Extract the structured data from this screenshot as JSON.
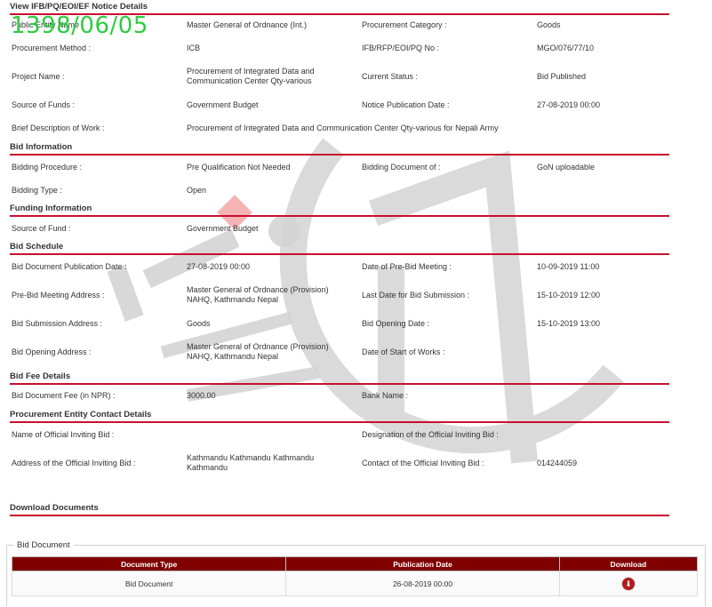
{
  "stamp": "1398/06/05",
  "notice": {
    "title": "View IFB/PQ/EOI/EF Notice Details",
    "pe_label": "Public Entity Name :",
    "pe_value": "Master General of Ordnance (Int.)",
    "cat_label": "Procurement Category :",
    "cat_value": "Goods",
    "method_label": "Procurement Method :",
    "method_value": "ICB",
    "ifb_label": "IFB/RFP/EOI/PQ No :",
    "ifb_value": "MGO/076/77/10",
    "project_label": "Project Name :",
    "project_value": "Procurement of Integrated Data and Communication Center Qty-various",
    "status_label": "Current Status :",
    "status_value": "Bid Published",
    "funds_label": "Source of Funds :",
    "funds_value": "Government Budget",
    "pubdate_label": "Notice Publication Date :",
    "pubdate_value": "27-08-2019 00:00",
    "brief_label": "Brief Description of Work :",
    "brief_value": "Procurement of Integrated Data and Communication Center Qty-various for Nepali Army"
  },
  "bid_info": {
    "title": "Bid Information",
    "proc_label": "Bidding Procedure :",
    "proc_value": "Pre Qualification Not Needed",
    "doc_label": "Bidding Document of :",
    "doc_value": "GoN uploadable",
    "type_label": "Bidding Type :",
    "type_value": "Open"
  },
  "funding": {
    "title": "Funding Information",
    "source_label": "Source of Fund :",
    "source_value": "Government Budget"
  },
  "schedule": {
    "title": "Bid Schedule",
    "docpub_label": "Bid Document Publication Date :",
    "docpub_value": "27-08-2019 00:00",
    "prebid_label": "Date of Pre-Bid Meeting :",
    "prebid_value": "10-09-2019 11:00",
    "prebid_addr_label": "Pre-Bid Meeting Address :",
    "prebid_addr_value": "Master General of Ordnance (Provision) NAHQ, Kathmandu Nepal",
    "lastdate_label": "Last Date for Bid Submission :",
    "lastdate_value": "15-10-2019 12:00",
    "sub_addr_label": "Bid Submission Address :",
    "sub_addr_value": "Goods",
    "opening_label": "Bid Opening Date :",
    "opening_value": "15-10-2019 13:00",
    "open_addr_label": "Bid Opening Address :",
    "open_addr_value": "Master General of Ordnance (Provision) NAHQ, Kathmandu Nepal",
    "start_label": "Date of Start of Works :",
    "start_value": ""
  },
  "fee": {
    "title": "Bid Fee Details",
    "fee_label": "Bid Document Fee (in NPR) :",
    "fee_value": "3000.00",
    "bank_label": "Bank Name :",
    "bank_value": ""
  },
  "contact": {
    "title": "Procurement Entity Contact Details",
    "official_label": "Name of Official Inviting Bid :",
    "official_value": "",
    "designation_label": "Designation of the Official Inviting Bid :",
    "designation_value": "",
    "address_label": "Address of the Official Inviting Bid :",
    "address_value": "Kathmandu Kathmandu Kathmandu Kathmandu",
    "phone_label": "Contact of the Official Inviting Bid :",
    "phone_value": "014244059"
  },
  "downloads": {
    "title": "Download Documents",
    "legend": "Bid Document",
    "headers": [
      "Document Type",
      "Publication Date",
      "Download"
    ],
    "rows": [
      {
        "type": "Bid Document",
        "date": "26-08-2019 00:00",
        "icon": "download-icon"
      }
    ]
  },
  "colors": {
    "accent": "#c8102e",
    "table_header": "#800000",
    "stamp": "#2ecc40"
  }
}
